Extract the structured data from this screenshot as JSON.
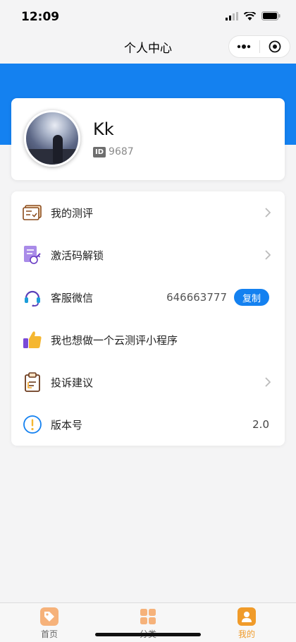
{
  "status": {
    "time": "12:09"
  },
  "nav": {
    "title": "个人中心"
  },
  "profile": {
    "name": "Kk",
    "id_badge": "ID",
    "id_value": "9687"
  },
  "menu": {
    "items": [
      {
        "label": "我的测评",
        "icon": "assessment-icon"
      },
      {
        "label": "激活码解锁",
        "icon": "activation-code-icon"
      },
      {
        "label": "客服微信",
        "icon": "customer-service-icon",
        "value": "646663777",
        "button": "复制"
      },
      {
        "label": "我也想做一个云测评小程序",
        "icon": "thumbs-up-icon"
      },
      {
        "label": "投诉建议",
        "icon": "clipboard-icon"
      },
      {
        "label": "版本号",
        "icon": "info-icon",
        "value": "2.0"
      }
    ]
  },
  "tabbar": {
    "tabs": [
      {
        "label": "首页",
        "icon": "home-tag-icon"
      },
      {
        "label": "分类",
        "icon": "category-grid-icon"
      },
      {
        "label": "我的",
        "icon": "profile-icon"
      }
    ],
    "active_color": "#f09b2a"
  },
  "colors": {
    "accent": "#1481f0",
    "background": "#f4f4f5"
  }
}
